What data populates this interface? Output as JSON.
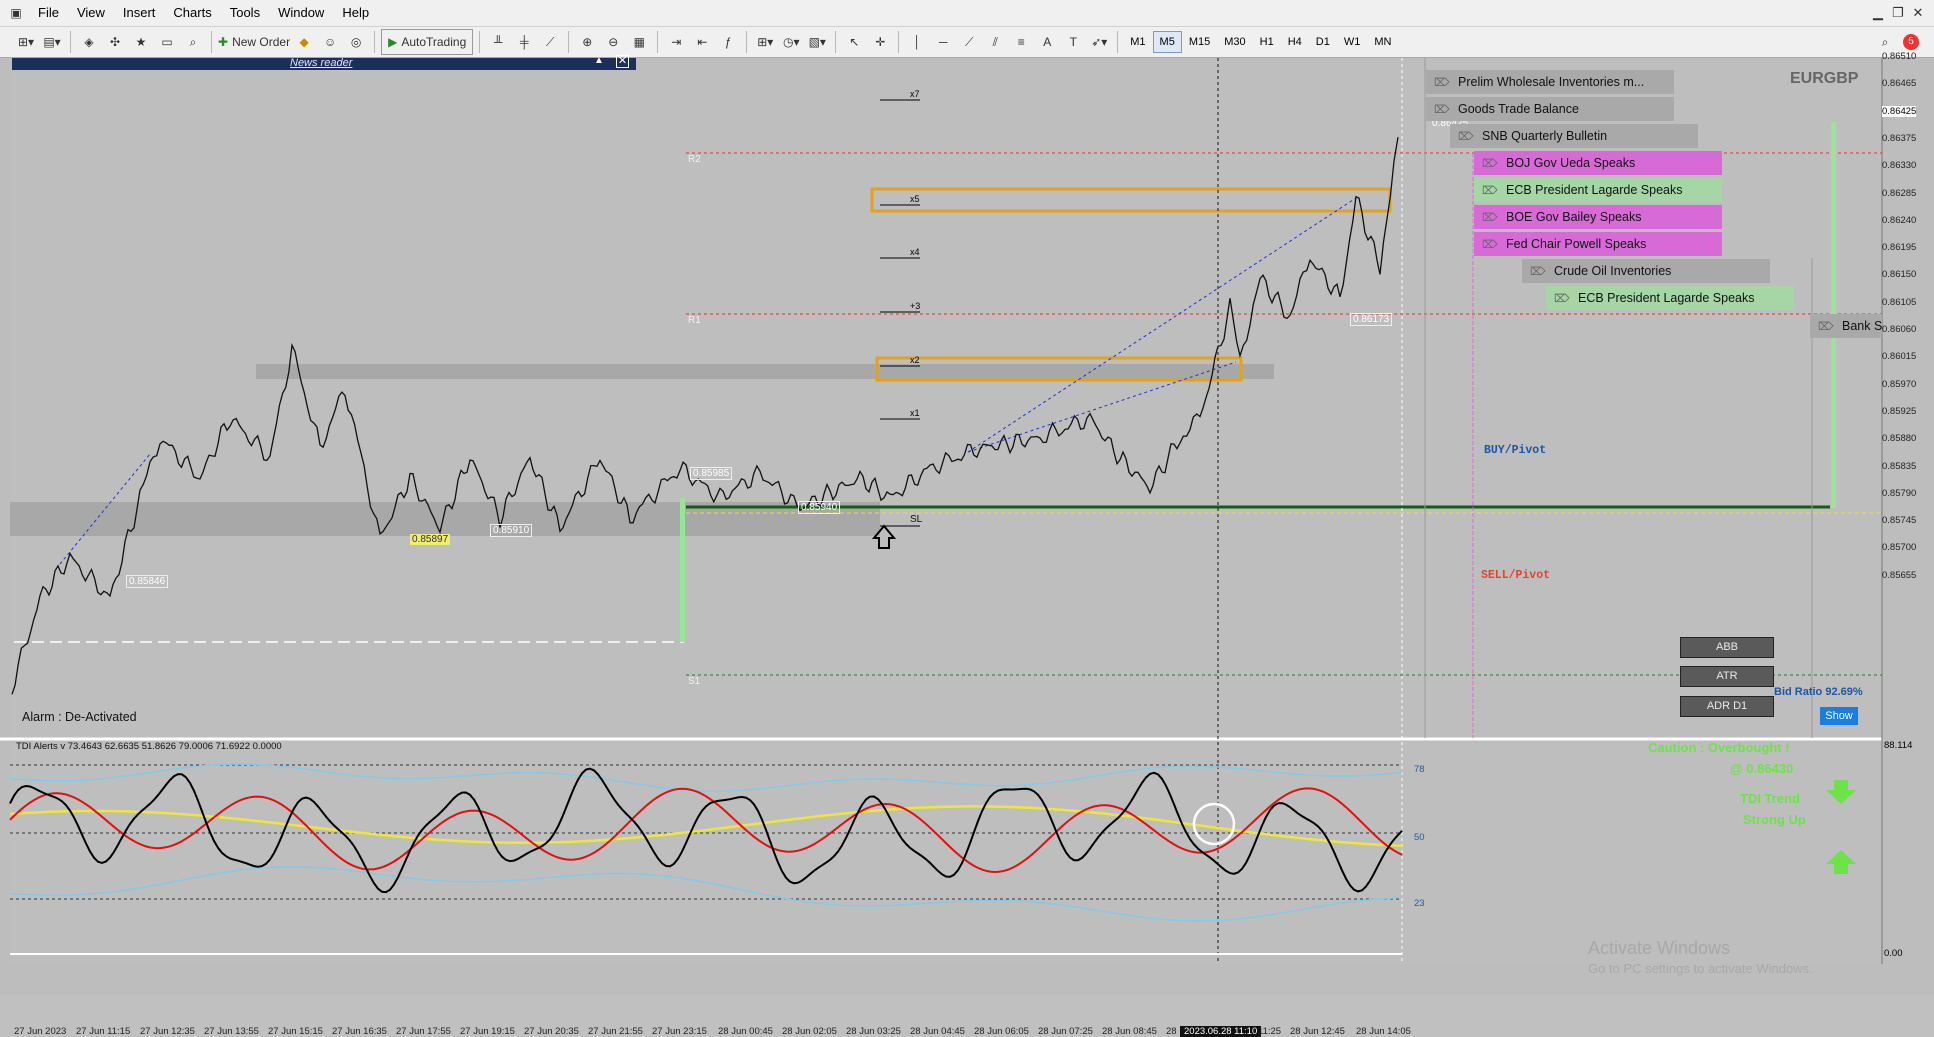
{
  "menu": [
    "File",
    "View",
    "Insert",
    "Charts",
    "Tools",
    "Window",
    "Help"
  ],
  "window_controls": [
    "minimize-icon",
    "restore-icon",
    "close-icon"
  ],
  "toolbar": {
    "new_order": "New Order",
    "autotrading": "AutoTrading",
    "timeframes": [
      "M1",
      "M5",
      "M15",
      "M30",
      "H1",
      "H4",
      "D1",
      "W1",
      "MN"
    ],
    "active_timeframe": "M5",
    "notification_count": "5"
  },
  "chart": {
    "symbol": "EURGBP",
    "news_reader": "News reader",
    "alarm": "Alarm : De-Activated",
    "levels": {
      "r2": "R2",
      "r1": "R1",
      "s1": "S1",
      "sl": "SL"
    },
    "targets": [
      "x7",
      "x5",
      "x4",
      "+3",
      "x2",
      "x1"
    ],
    "buy_pivot": "BUY/Pivot",
    "sell_pivot": "SELL/Pivot",
    "buttons": [
      "ABB",
      "ATR",
      "ADR D1"
    ],
    "bid_ratio": "Bid Ratio 92.69%",
    "show_button": "Show",
    "price_tags": [
      "0.85846",
      "0.85897",
      "0.85910",
      "0.85985",
      "0.85940",
      "0.86173",
      "0.86425"
    ],
    "events": [
      "Prelim Wholesale Inventories m...",
      "Goods Trade Balance",
      "SNB Quarterly Bulletin",
      "BOJ Gov Ueda Speaks",
      "ECB President Lagarde Speaks",
      "BOE Gov Bailey Speaks",
      "Fed Chair Powell Speaks",
      "Crude Oil Inventories",
      "ECB President Lagarde Speaks",
      "Bank S"
    ],
    "price_axis": [
      "0.86510",
      "0.86465",
      "0.86425",
      "0.86375",
      "0.86330",
      "0.86285",
      "0.86240",
      "0.86195",
      "0.86150",
      "0.86105",
      "0.86060",
      "0.86015",
      "0.85970",
      "0.85925",
      "0.85880",
      "0.85835",
      "0.85790",
      "0.85745",
      "0.85700",
      "0.85655"
    ],
    "time_axis": [
      "27 Jun 2023",
      "27 Jun 11:15",
      "27 Jun 12:35",
      "27 Jun 13:55",
      "27 Jun 15:15",
      "27 Jun 16:35",
      "27 Jun 17:55",
      "27 Jun 19:15",
      "27 Jun 20:35",
      "27 Jun 21:55",
      "27 Jun 23:15",
      "28 Jun 00:45",
      "28 Jun 02:05",
      "28 Jun 03:25",
      "28 Jun 04:45",
      "28 Jun 06:05",
      "28 Jun 07:25",
      "28 Jun 08:45",
      "28",
      "2023.06.28 11:10",
      "11:25",
      "28 Jun 12:45",
      "28 Jun 14:05"
    ]
  },
  "indicator": {
    "label": "TDI Alerts v 73.4643 62.6635 51.8626 79.0006 71.6922 0.0000",
    "levels": [
      "78",
      "50",
      "23"
    ],
    "axis_top": "88.114",
    "axis_bottom": "0.00",
    "caution_line1": "Caution : Overbought !",
    "caution_line2": "@ 0.86430",
    "trend_line1": "TDI Trend",
    "trend_line2": "Strong Up"
  },
  "watermark": {
    "line1": "Activate Windows",
    "line2": "Go to PC settings to activate Windows."
  },
  "colors": {
    "bull": "#9be29b",
    "pink": "#d86ad8",
    "green_event": "#a6d6a6",
    "gray_event": "#a9a9a9",
    "orange": "#e3a21a",
    "buy": "#1c56a8",
    "sell": "#e0442a",
    "lime": "#6de34a"
  }
}
